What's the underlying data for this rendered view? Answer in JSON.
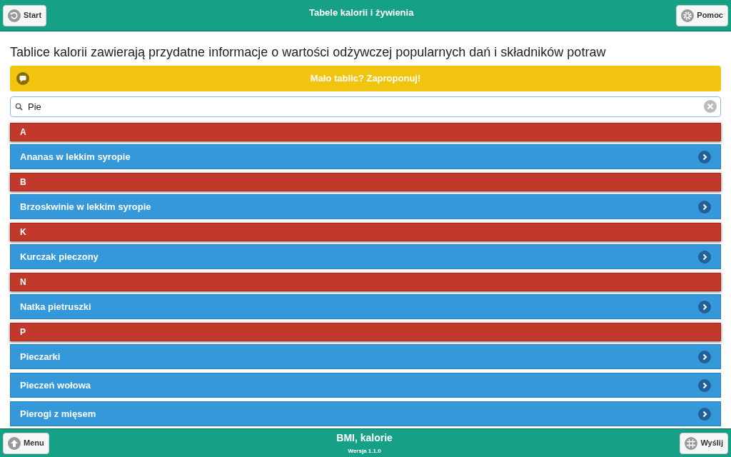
{
  "header": {
    "title": "Tabele kalorii i żywienia",
    "left_button": "Start",
    "right_button": "Pomoc"
  },
  "intro": "Tablice kalorii zawierają przydatne informacje o wartości odżywczej popularnych dań i składników potraw",
  "banner": "Mało tablic? Zaproponuj!",
  "search": {
    "value": "Pie"
  },
  "list": [
    {
      "kind": "divider",
      "label": "A"
    },
    {
      "kind": "item",
      "label": "Ananas w lekkim syropie"
    },
    {
      "kind": "divider",
      "label": "B"
    },
    {
      "kind": "item",
      "label": "Brzoskwinie w lekkim syropie"
    },
    {
      "kind": "divider",
      "label": "K"
    },
    {
      "kind": "item",
      "label": "Kurczak pieczony"
    },
    {
      "kind": "divider",
      "label": "N"
    },
    {
      "kind": "item",
      "label": "Natka pietruszki"
    },
    {
      "kind": "divider",
      "label": "P"
    },
    {
      "kind": "item",
      "label": "Pieczarki"
    },
    {
      "kind": "item",
      "label": "Pieczeń wołowa"
    },
    {
      "kind": "item",
      "label": "Pierogi z mięsem"
    }
  ],
  "footer": {
    "title": "BMI, kalorie",
    "version": "Wersja 1.1.0",
    "left_button": "Menu",
    "right_button": "Wyślij"
  }
}
